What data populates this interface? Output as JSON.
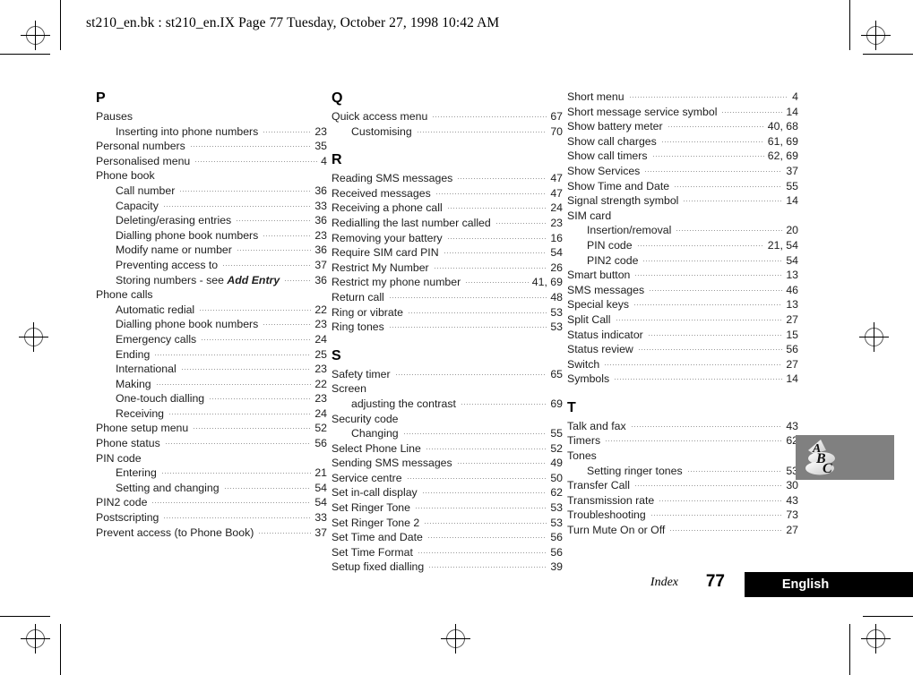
{
  "header": {
    "text": "st210_en.bk : st210_en.IX  Page 77  Tuesday, October 27, 1998  10:42 AM"
  },
  "footer": {
    "index_label": "Index",
    "page_number": "77",
    "language": "English",
    "bar_color": "#000000"
  },
  "graphic": {
    "name": "abc-graphic",
    "background_color": "#808080",
    "letters": [
      "A",
      "B",
      "C"
    ]
  },
  "columns": [
    {
      "id": "column-1",
      "groups": [
        {
          "letter": "P",
          "entries": [
            {
              "label": "Pauses",
              "page": "",
              "sub": false,
              "leader": false
            },
            {
              "label": "Inserting into phone numbers",
              "page": "23",
              "sub": true,
              "leader": true
            },
            {
              "label": "Personal numbers",
              "page": "35",
              "sub": false,
              "leader": true
            },
            {
              "label": "Personalised menu",
              "page": "4",
              "sub": false,
              "leader": true
            },
            {
              "label": "Phone book",
              "page": "",
              "sub": false,
              "leader": false
            },
            {
              "label": "Call number",
              "page": "36",
              "sub": true,
              "leader": true
            },
            {
              "label": "Capacity",
              "page": "33",
              "sub": true,
              "leader": true
            },
            {
              "label": "Deleting/erasing entries",
              "page": "36",
              "sub": true,
              "leader": true
            },
            {
              "label": "Dialling phone book numbers",
              "page": "23",
              "sub": true,
              "leader": true
            },
            {
              "label": "Modify name or number",
              "page": "36",
              "sub": true,
              "leader": true
            },
            {
              "label": "Preventing access to",
              "page": "37",
              "sub": true,
              "leader": true
            },
            {
              "label": "Storing numbers - see ",
              "emph": "Add Entry",
              "page": "36",
              "sub": true,
              "leader": true
            },
            {
              "label": "Phone calls",
              "page": "",
              "sub": false,
              "leader": false
            },
            {
              "label": "Automatic redial",
              "page": "22",
              "sub": true,
              "leader": true
            },
            {
              "label": "Dialling phone book numbers",
              "page": "23",
              "sub": true,
              "leader": true
            },
            {
              "label": "Emergency calls",
              "page": "24",
              "sub": true,
              "leader": true
            },
            {
              "label": "Ending",
              "page": "25",
              "sub": true,
              "leader": true
            },
            {
              "label": "International",
              "page": "23",
              "sub": true,
              "leader": true
            },
            {
              "label": "Making",
              "page": "22",
              "sub": true,
              "leader": true
            },
            {
              "label": "One-touch dialling",
              "page": "23",
              "sub": true,
              "leader": true
            },
            {
              "label": "Receiving",
              "page": "24",
              "sub": true,
              "leader": true
            },
            {
              "label": "Phone setup menu",
              "page": "52",
              "sub": false,
              "leader": true
            },
            {
              "label": "Phone status",
              "page": "56",
              "sub": false,
              "leader": true
            },
            {
              "label": "PIN code",
              "page": "",
              "sub": false,
              "leader": false
            },
            {
              "label": "Entering",
              "page": "21",
              "sub": true,
              "leader": true
            },
            {
              "label": "Setting and changing",
              "page": "54",
              "sub": true,
              "leader": true
            },
            {
              "label": "PIN2 code",
              "page": "54",
              "sub": false,
              "leader": true
            },
            {
              "label": "Postscripting",
              "page": "33",
              "sub": false,
              "leader": true
            },
            {
              "label": "Prevent access (to Phone Book)",
              "page": "37",
              "sub": false,
              "leader": true
            }
          ]
        }
      ]
    },
    {
      "id": "column-2",
      "groups": [
        {
          "letter": "Q",
          "entries": [
            {
              "label": "Quick access menu",
              "page": "67",
              "sub": false,
              "leader": true
            },
            {
              "label": "Customising",
              "page": "70",
              "sub": true,
              "leader": true
            }
          ]
        },
        {
          "letter": "R",
          "entries": [
            {
              "label": "Reading SMS messages",
              "page": "47",
              "sub": false,
              "leader": true
            },
            {
              "label": "Received messages",
              "page": "47",
              "sub": false,
              "leader": true
            },
            {
              "label": "Receiving a phone call",
              "page": "24",
              "sub": false,
              "leader": true
            },
            {
              "label": "Redialling the last number called",
              "page": "23",
              "sub": false,
              "leader": true
            },
            {
              "label": "Removing your battery",
              "page": "16",
              "sub": false,
              "leader": true
            },
            {
              "label": "Require SIM card PIN",
              "page": "54",
              "sub": false,
              "leader": true
            },
            {
              "label": "Restrict My Number",
              "page": "26",
              "sub": false,
              "leader": true
            },
            {
              "label": "Restrict my phone number",
              "page": "41, 69",
              "sub": false,
              "leader": true
            },
            {
              "label": "Return call",
              "page": "48",
              "sub": false,
              "leader": true
            },
            {
              "label": "Ring or vibrate",
              "page": "53",
              "sub": false,
              "leader": true
            },
            {
              "label": "Ring tones",
              "page": "53",
              "sub": false,
              "leader": true
            }
          ]
        },
        {
          "letter": "S",
          "entries": [
            {
              "label": "Safety timer",
              "page": "65",
              "sub": false,
              "leader": true
            },
            {
              "label": "Screen",
              "page": "",
              "sub": false,
              "leader": false
            },
            {
              "label": "adjusting the contrast",
              "page": "69",
              "sub": true,
              "leader": true
            },
            {
              "label": "Security code",
              "page": "",
              "sub": false,
              "leader": false
            },
            {
              "label": "Changing",
              "page": "55",
              "sub": true,
              "leader": true
            },
            {
              "label": "Select Phone Line",
              "page": "52",
              "sub": false,
              "leader": true
            },
            {
              "label": "Sending SMS messages",
              "page": "49",
              "sub": false,
              "leader": true
            },
            {
              "label": "Service centre",
              "page": "50",
              "sub": false,
              "leader": true
            },
            {
              "label": "Set in-call display",
              "page": "62",
              "sub": false,
              "leader": true
            },
            {
              "label": "Set Ringer Tone",
              "page": "53",
              "sub": false,
              "leader": true
            },
            {
              "label": "Set Ringer Tone 2",
              "page": "53",
              "sub": false,
              "leader": true
            },
            {
              "label": "Set Time and Date",
              "page": "56",
              "sub": false,
              "leader": true
            },
            {
              "label": "Set Time Format",
              "page": "56",
              "sub": false,
              "leader": true
            },
            {
              "label": "Setup fixed dialling",
              "page": "39",
              "sub": false,
              "leader": true
            }
          ]
        }
      ]
    },
    {
      "id": "column-3",
      "groups": [
        {
          "letter": "",
          "entries": [
            {
              "label": "Short menu",
              "page": "4",
              "sub": false,
              "leader": true
            },
            {
              "label": "Short message service symbol",
              "page": "14",
              "sub": false,
              "leader": true
            },
            {
              "label": "Show battery meter",
              "page": "40, 68",
              "sub": false,
              "leader": true
            },
            {
              "label": "Show call charges",
              "page": "61, 69",
              "sub": false,
              "leader": true
            },
            {
              "label": "Show call timers",
              "page": "62, 69",
              "sub": false,
              "leader": true
            },
            {
              "label": "Show Services",
              "page": "37",
              "sub": false,
              "leader": true
            },
            {
              "label": "Show Time and Date",
              "page": "55",
              "sub": false,
              "leader": true
            },
            {
              "label": "Signal strength symbol",
              "page": "14",
              "sub": false,
              "leader": true
            },
            {
              "label": "SIM card",
              "page": "",
              "sub": false,
              "leader": false
            },
            {
              "label": "Insertion/removal",
              "page": "20",
              "sub": true,
              "leader": true
            },
            {
              "label": "PIN code",
              "page": "21, 54",
              "sub": true,
              "leader": true
            },
            {
              "label": "PIN2 code",
              "page": "54",
              "sub": true,
              "leader": true
            },
            {
              "label": "Smart button",
              "page": "13",
              "sub": false,
              "leader": true
            },
            {
              "label": "SMS messages",
              "page": "46",
              "sub": false,
              "leader": true
            },
            {
              "label": "Special keys",
              "page": "13",
              "sub": false,
              "leader": true
            },
            {
              "label": "Split Call",
              "page": "27",
              "sub": false,
              "leader": true
            },
            {
              "label": "Status indicator",
              "page": "15",
              "sub": false,
              "leader": true
            },
            {
              "label": "Status review",
              "page": "56",
              "sub": false,
              "leader": true
            },
            {
              "label": "Switch",
              "page": "27",
              "sub": false,
              "leader": true
            },
            {
              "label": "Symbols",
              "page": "14",
              "sub": false,
              "leader": true
            }
          ]
        },
        {
          "letter": "T",
          "entries": [
            {
              "label": "Talk and fax",
              "page": "43",
              "sub": false,
              "leader": true
            },
            {
              "label": "Timers",
              "page": "62",
              "sub": false,
              "leader": true
            },
            {
              "label": "Tones",
              "page": "",
              "sub": false,
              "leader": false
            },
            {
              "label": "Setting ringer tones",
              "page": "53",
              "sub": true,
              "leader": true
            },
            {
              "label": "Transfer Call",
              "page": "30",
              "sub": false,
              "leader": true
            },
            {
              "label": "Transmission rate",
              "page": "43",
              "sub": false,
              "leader": true
            },
            {
              "label": "Troubleshooting",
              "page": "73",
              "sub": false,
              "leader": true
            },
            {
              "label": "Turn Mute On or Off",
              "page": "27",
              "sub": false,
              "leader": true
            }
          ]
        }
      ]
    }
  ]
}
